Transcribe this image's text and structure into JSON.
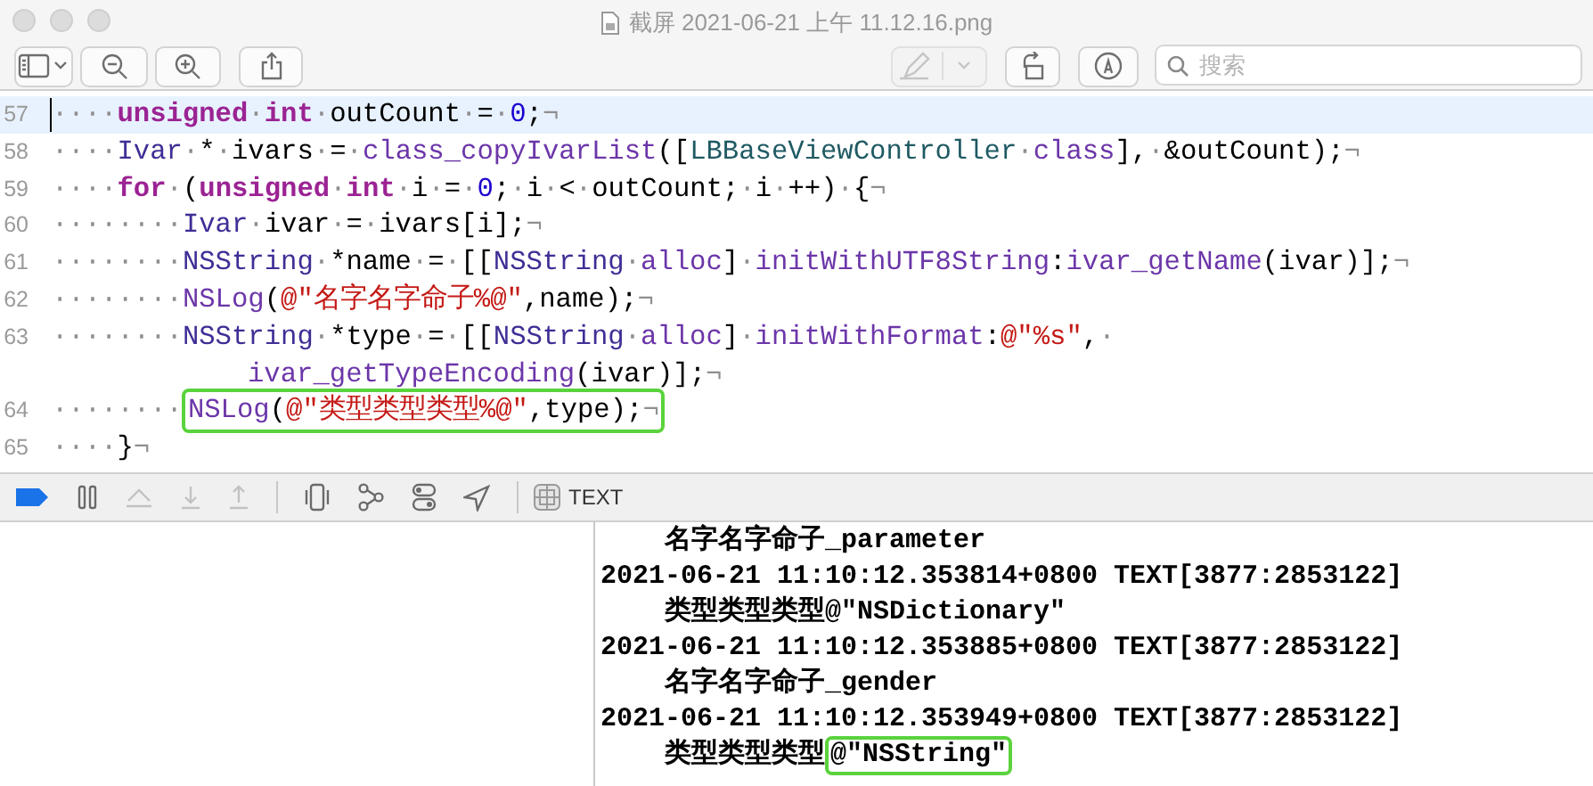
{
  "window": {
    "title": "截屏 2021-06-21 上午 11.12.16.png"
  },
  "toolbar": {
    "left": [
      {
        "kind": "sidebar",
        "disabled": false
      },
      {
        "kind": "zoom_out",
        "disabled": false
      },
      {
        "kind": "zoom_in",
        "disabled": false
      },
      {
        "kind": "share",
        "disabled": false
      }
    ],
    "right": [
      {
        "kind": "markup",
        "disabled": true
      },
      {
        "kind": "rotate",
        "disabled": false
      },
      {
        "kind": "annotate",
        "disabled": false
      }
    ],
    "search": {
      "placeholder": "搜索"
    }
  },
  "editor": {
    "lines": [
      {
        "number": "57",
        "current": true,
        "tokens": [
          {
            "kind": "plain",
            "text": "····"
          },
          {
            "kind": "keyword",
            "text": "unsigned·int"
          },
          {
            "kind": "plain",
            "text": "·outCount·=·"
          },
          {
            "kind": "number",
            "text": "0"
          },
          {
            "kind": "plain",
            "text": ";¬"
          }
        ]
      },
      {
        "number": "58",
        "current": false,
        "tokens": [
          {
            "kind": "plain",
            "text": "····"
          },
          {
            "kind": "type",
            "text": "Ivar"
          },
          {
            "kind": "plain",
            "text": "·*·ivars·=·"
          },
          {
            "kind": "function",
            "text": "class_copyIvarList"
          },
          {
            "kind": "plain",
            "text": "(["
          },
          {
            "kind": "class",
            "text": "LBBaseViewController"
          },
          {
            "kind": "plain",
            "text": "·"
          },
          {
            "kind": "function",
            "text": "class"
          },
          {
            "kind": "plain",
            "text": "],·&outCount);¬"
          }
        ]
      },
      {
        "number": "59",
        "current": false,
        "tokens": [
          {
            "kind": "plain",
            "text": "····"
          },
          {
            "kind": "keyword",
            "text": "for"
          },
          {
            "kind": "plain",
            "text": "·("
          },
          {
            "kind": "keyword",
            "text": "unsigned·int"
          },
          {
            "kind": "plain",
            "text": "·i·=·"
          },
          {
            "kind": "number",
            "text": "0"
          },
          {
            "kind": "plain",
            "text": ";·i·<·outCount;·i·++)·{¬"
          }
        ]
      },
      {
        "number": "60",
        "current": false,
        "tokens": [
          {
            "kind": "plain",
            "text": "········"
          },
          {
            "kind": "type",
            "text": "Ivar"
          },
          {
            "kind": "plain",
            "text": "·ivar·=·ivars[i];¬"
          }
        ]
      },
      {
        "number": "61",
        "current": false,
        "tokens": [
          {
            "kind": "plain",
            "text": "········"
          },
          {
            "kind": "type",
            "text": "NSString"
          },
          {
            "kind": "plain",
            "text": "·*name·=·[["
          },
          {
            "kind": "type",
            "text": "NSString"
          },
          {
            "kind": "plain",
            "text": "·"
          },
          {
            "kind": "function",
            "text": "alloc"
          },
          {
            "kind": "plain",
            "text": "]·"
          },
          {
            "kind": "function",
            "text": "initWithUTF8String"
          },
          {
            "kind": "plain",
            "text": ":"
          },
          {
            "kind": "function",
            "text": "ivar_getName"
          },
          {
            "kind": "plain",
            "text": "(ivar)];¬"
          }
        ]
      },
      {
        "number": "62",
        "current": false,
        "tokens": [
          {
            "kind": "plain",
            "text": "········"
          },
          {
            "kind": "function",
            "text": "NSLog"
          },
          {
            "kind": "plain",
            "text": "("
          },
          {
            "kind": "string",
            "text": "@\"名字名字命子%@\""
          },
          {
            "kind": "plain",
            "text": ",name);¬"
          }
        ]
      },
      {
        "number": "63",
        "current": false,
        "tokens": [
          {
            "kind": "plain",
            "text": "········"
          },
          {
            "kind": "type",
            "text": "NSString"
          },
          {
            "kind": "plain",
            "text": "·*type·=·[["
          },
          {
            "kind": "type",
            "text": "NSString"
          },
          {
            "kind": "plain",
            "text": "·"
          },
          {
            "kind": "function",
            "text": "alloc"
          },
          {
            "kind": "plain",
            "text": "]·"
          },
          {
            "kind": "function",
            "text": "initWithFormat"
          },
          {
            "kind": "plain",
            "text": ":"
          },
          {
            "kind": "string",
            "text": "@\"%s\""
          },
          {
            "kind": "plain",
            "text": ",·"
          }
        ]
      },
      {
        "current": false,
        "continuation": true,
        "tokens": [
          {
            "kind": "function",
            "text": "ivar_getTypeEncoding"
          },
          {
            "kind": "plain",
            "text": "(ivar)];¬"
          }
        ]
      },
      {
        "number": "64",
        "current": false,
        "tokens": [
          {
            "kind": "plain",
            "text": "········"
          },
          {
            "kind": "function",
            "text": "NSLog",
            "boxed": true
          },
          {
            "kind": "plain",
            "text": "(",
            "boxed": true
          },
          {
            "kind": "string",
            "text": "@\"类型类型类型%@\"",
            "boxed": true
          },
          {
            "kind": "plain",
            "text": ",type);¬",
            "boxed": true
          }
        ]
      },
      {
        "number": "65",
        "current": false,
        "tokens": [
          {
            "kind": "plain",
            "text": "····}¬"
          }
        ]
      }
    ]
  },
  "debug_bar": {
    "items": [
      {
        "kind": "breakpoints",
        "on": true
      },
      {
        "kind": "pause",
        "disabled": false
      },
      {
        "kind": "step_over",
        "disabled": true
      },
      {
        "kind": "step_into",
        "disabled": true
      },
      {
        "kind": "step_out",
        "disabled": true
      },
      {
        "kind": "separator"
      },
      {
        "kind": "view_debugger",
        "disabled": false
      },
      {
        "kind": "memory_graph",
        "disabled": false
      },
      {
        "kind": "environment",
        "disabled": false
      },
      {
        "kind": "location",
        "disabled": false
      },
      {
        "kind": "separator"
      }
    ],
    "target": "TEXT"
  },
  "console": {
    "lines": [
      {
        "segments": [
          {
            "text": "    名字名字命子_parameter",
            "boxed": false
          }
        ]
      },
      {
        "segments": [
          {
            "text": "2021-06-21 11:10:12.353814+0800 TEXT[3877:2853122]",
            "boxed": false
          }
        ]
      },
      {
        "segments": [
          {
            "text": "    类型类型类型@\"NSDictionary\"",
            "boxed": false
          }
        ]
      },
      {
        "segments": [
          {
            "text": "2021-06-21 11:10:12.353885+0800 TEXT[3877:2853122]",
            "boxed": false
          }
        ]
      },
      {
        "segments": [
          {
            "text": "    名字名字命子_gender",
            "boxed": false
          }
        ]
      },
      {
        "segments": [
          {
            "text": "2021-06-21 11:10:12.353949+0800 TEXT[3877:2853122]",
            "boxed": false
          }
        ]
      },
      {
        "segments": [
          {
            "text": "    类型类型类型",
            "boxed": false
          },
          {
            "text": "@\"NSString\"",
            "boxed": true
          }
        ]
      }
    ]
  }
}
